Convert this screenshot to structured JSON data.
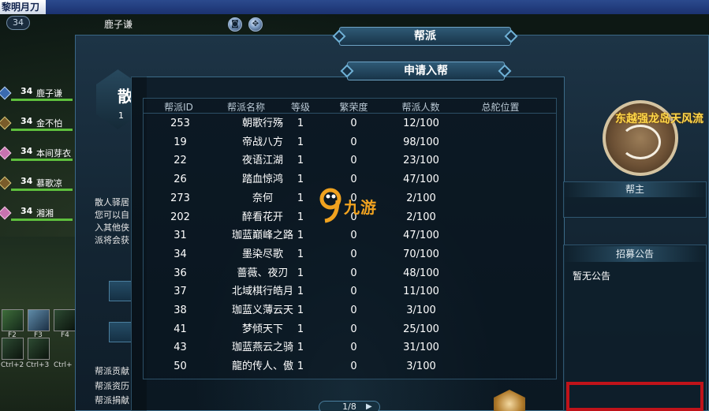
{
  "window": {
    "title": "黎明月刀"
  },
  "player": {
    "level": "34",
    "name": "鹿子谦"
  },
  "team": [
    {
      "level": "34",
      "name": "鹿子谦"
    },
    {
      "level": "34",
      "name": "金不怕"
    },
    {
      "level": "34",
      "name": "本间芽衣"
    },
    {
      "level": "34",
      "name": "慕歌凉"
    },
    {
      "level": "34",
      "name": "湘湘"
    }
  ],
  "skills": {
    "keys": [
      "F2",
      "F3",
      "F4",
      "Ctrl+2",
      "Ctrl+3",
      "Ctrl+"
    ]
  },
  "guild_panel": {
    "title": "帮派",
    "left_text_lines": [
      "散人驿居",
      "您可以自",
      "入其他侠",
      "派将会获"
    ],
    "bottom_left_lines": [
      "帮派贡献",
      "帮派资历",
      "帮派捐献"
    ]
  },
  "apply_window": {
    "title": "申请入帮",
    "headers": [
      "帮派ID",
      "帮派名称",
      "等级",
      "繁荣度",
      "帮派人数",
      "总舵位置"
    ],
    "rows": [
      {
        "id": "253",
        "name": "朝歌行殇",
        "level": "1",
        "prosperity": "0",
        "members": "12/100",
        "location": ""
      },
      {
        "id": "19",
        "name": "帝战八方",
        "level": "1",
        "prosperity": "0",
        "members": "98/100",
        "location": ""
      },
      {
        "id": "22",
        "name": "夜语江湖",
        "level": "1",
        "prosperity": "0",
        "members": "23/100",
        "location": ""
      },
      {
        "id": "26",
        "name": "踏血惊鸿",
        "level": "1",
        "prosperity": "0",
        "members": "47/100",
        "location": ""
      },
      {
        "id": "273",
        "name": "奈何",
        "level": "1",
        "prosperity": "0",
        "members": "2/100",
        "location": ""
      },
      {
        "id": "202",
        "name": "醉看花开",
        "level": "1",
        "prosperity": "0",
        "members": "2/100",
        "location": ""
      },
      {
        "id": "31",
        "name": "珈蓝巅峰之路",
        "level": "1",
        "prosperity": "0",
        "members": "47/100",
        "location": ""
      },
      {
        "id": "34",
        "name": "墨染尽歌",
        "level": "1",
        "prosperity": "0",
        "members": "70/100",
        "location": ""
      },
      {
        "id": "36",
        "name": "蔷薇、夜刃",
        "level": "1",
        "prosperity": "0",
        "members": "48/100",
        "location": ""
      },
      {
        "id": "37",
        "name": "北域棋行皓月",
        "level": "1",
        "prosperity": "0",
        "members": "11/100",
        "location": ""
      },
      {
        "id": "38",
        "name": "珈蓝义薄云天",
        "level": "1",
        "prosperity": "0",
        "members": "3/100",
        "location": ""
      },
      {
        "id": "41",
        "name": "梦倾天下",
        "level": "1",
        "prosperity": "0",
        "members": "25/100",
        "location": ""
      },
      {
        "id": "43",
        "name": "珈蓝燕云之骑",
        "level": "1",
        "prosperity": "0",
        "members": "31/100",
        "location": ""
      },
      {
        "id": "50",
        "name": "龍的传人、傲",
        "level": "1",
        "prosperity": "0",
        "members": "3/100",
        "location": ""
      }
    ],
    "pager": "1/8"
  },
  "selected_guild": {
    "emblem_name": "东越强龙岛天风流",
    "leader_label": "帮主",
    "leader_value": "",
    "notice_label": "招募公告",
    "notice_text": "暂无公告"
  },
  "watermark": {
    "text": "九游"
  },
  "colors": {
    "highlight_border": "#c0131a",
    "guild_name": "#ffd84a",
    "hp": "#5ebf3d",
    "mp": "#3c6fc4"
  }
}
